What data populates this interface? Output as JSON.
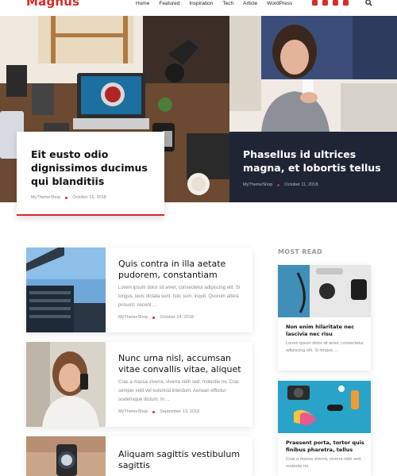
{
  "site": {
    "logo": "Magnus"
  },
  "nav": {
    "items": [
      "Home",
      "Featured",
      "Inspiration",
      "Tech",
      "Article",
      "WordPress"
    ]
  },
  "social": {
    "icons": [
      "facebook-icon",
      "twitter-icon",
      "instagram-icon",
      "youtube-icon"
    ],
    "accent": "#d62b2b"
  },
  "hero": {
    "left": {
      "title": "Eit eusto odio dignissimos ducimus qui blanditiis",
      "author": "MyThemeShop",
      "date": "October 16, 2018"
    },
    "right": {
      "title": "Phasellus id ultrices magna, et lobortis tellus",
      "author": "MyThemeShop",
      "date": "October 11, 2018"
    }
  },
  "articles": [
    {
      "title": "Quis contra in illa aetate pudorem, constantiam",
      "excerpt": "Lorem ipsum dolor sit amet, consectetur adipiscing elit. Si longus, levis dictata sunt. Istic sum, inquit. Quorum altera prosunt, nocent ...",
      "author": "MyThemeShop",
      "date": "October 14, 2018"
    },
    {
      "title": "Nunc urna nisl, accumsan vitae convallis vitae, aliquet",
      "excerpt": "Cras a massa viverra, viverra nibh sed, molestie mi. Cras semper velit vel euismod interdum. Aenean efficitur scelerisque dictum. In ...",
      "author": "MyThemeShop",
      "date": "September 13, 2018"
    },
    {
      "title": "Aliquam sagittis vestibulum sagittis",
      "excerpt": "",
      "author": "",
      "date": ""
    }
  ],
  "sidebar": {
    "title": "MOST READ",
    "items": [
      {
        "title": "Non enim hilaritate nec lascivia nec risu",
        "excerpt": "Lorem ipsum dolor sit amet, consectetur adipiscing elit. Si longus, ..."
      },
      {
        "title": "Praesent porta, tortor quis finibus pharetra, tellus",
        "excerpt": "Cras a massa viverra, viverra nibh sed, molestie mi."
      }
    ]
  },
  "colors": {
    "accent": "#d62b2b",
    "dark_bar": "#1f2535"
  }
}
